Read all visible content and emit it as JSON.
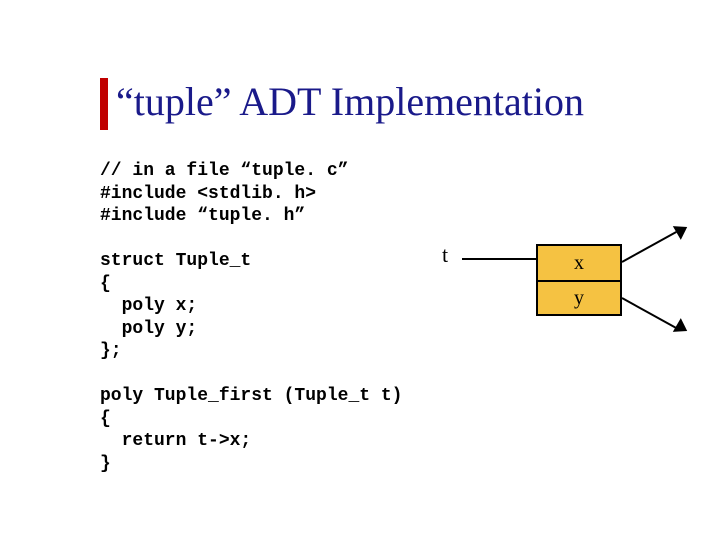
{
  "slide": {
    "title": "“tuple” ADT Implementation",
    "code": "// in a file “tuple. c”\n#include <stdlib. h>\n#include “tuple. h”\n\nstruct Tuple_t\n{\n  poly x;\n  poly y;\n};\n\npoly Tuple_first (Tuple_t t)\n{\n  return t->x;\n}"
  },
  "diagram": {
    "pointer_label": "t",
    "field_x": "x",
    "field_y": "y"
  }
}
